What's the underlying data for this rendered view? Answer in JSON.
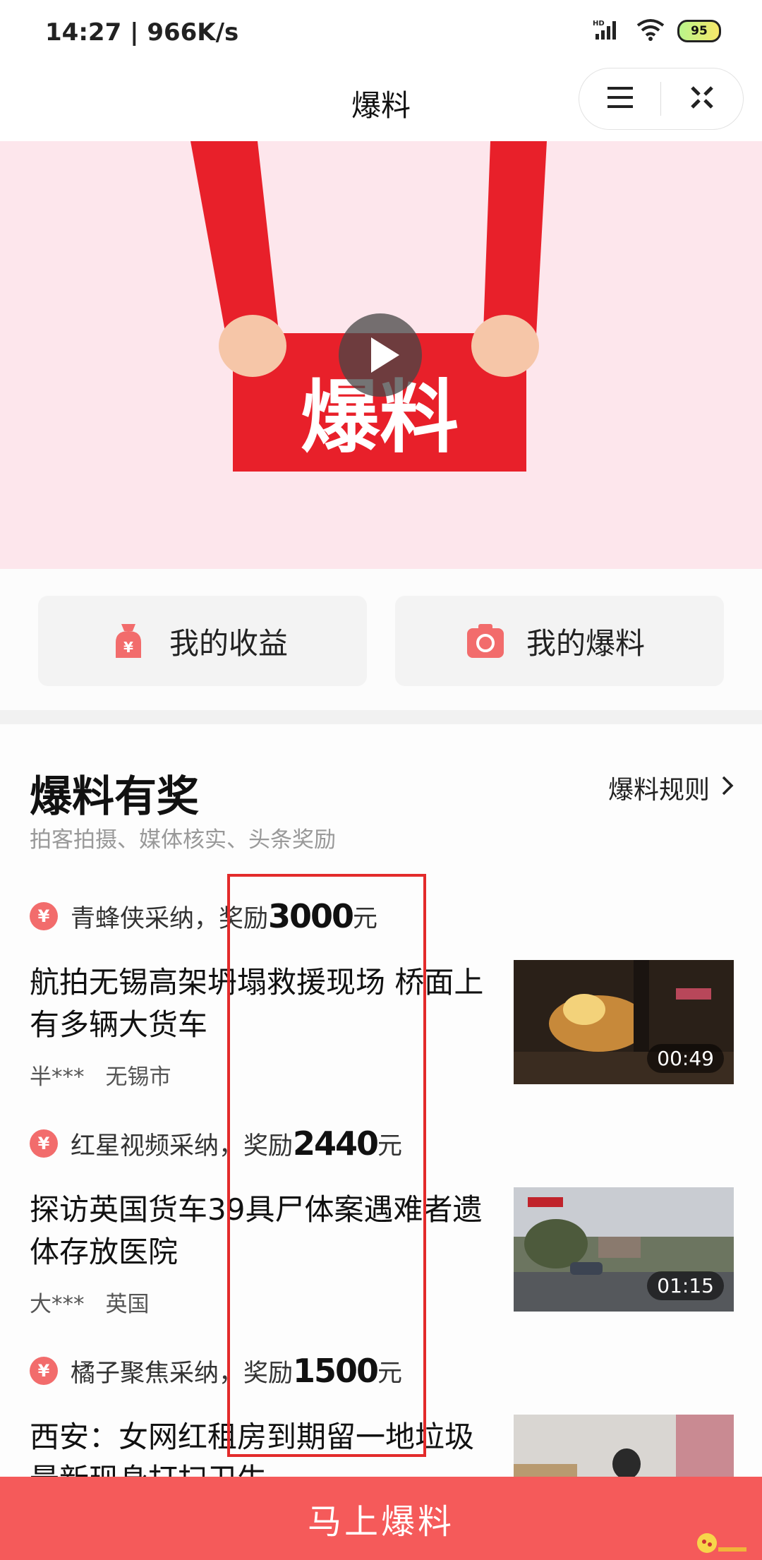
{
  "status_bar": {
    "time": "14:27 | 966K/s",
    "battery": "95",
    "signal_label": "HD"
  },
  "header": {
    "title": "爆料"
  },
  "banner": {
    "sign_text": "爆料"
  },
  "quick_actions": [
    {
      "label": "我的收益",
      "icon": "money-bag-icon"
    },
    {
      "label": "我的爆料",
      "icon": "camera-icon"
    }
  ],
  "section": {
    "title": "爆料有奖",
    "subtitle": "拍客拍摄、媒体核实、头条奖励",
    "rules_link": "爆料规则"
  },
  "items": [
    {
      "reward_prefix": "青蜂侠采纳，奖励",
      "amount": "3000",
      "unit": "元",
      "headline": "航拍无锡高架坍塌救援现场 桥面上有多辆大货车",
      "user": "半***",
      "location": "无锡市",
      "duration": "00:49"
    },
    {
      "reward_prefix": "红星视频采纳，奖励",
      "amount": "2440",
      "unit": "元",
      "headline": "探访英国货车39具尸体案遇难者遗体存放医院",
      "user": "大***",
      "location": "英国",
      "duration": "01:15"
    },
    {
      "reward_prefix": "橘子聚焦采纳，奖励",
      "amount": "1500",
      "unit": "元",
      "headline": "西安：女网红租房到期留一地垃圾 最新现身打扫卫生",
      "user": "",
      "location": "",
      "duration": ""
    }
  ],
  "cta": {
    "label": "马上爆料"
  },
  "colors": {
    "accent": "#f55a5a",
    "banner_bg": "#fde6ec",
    "sign_red": "#e8202a",
    "highlight": "#e32b2b"
  }
}
